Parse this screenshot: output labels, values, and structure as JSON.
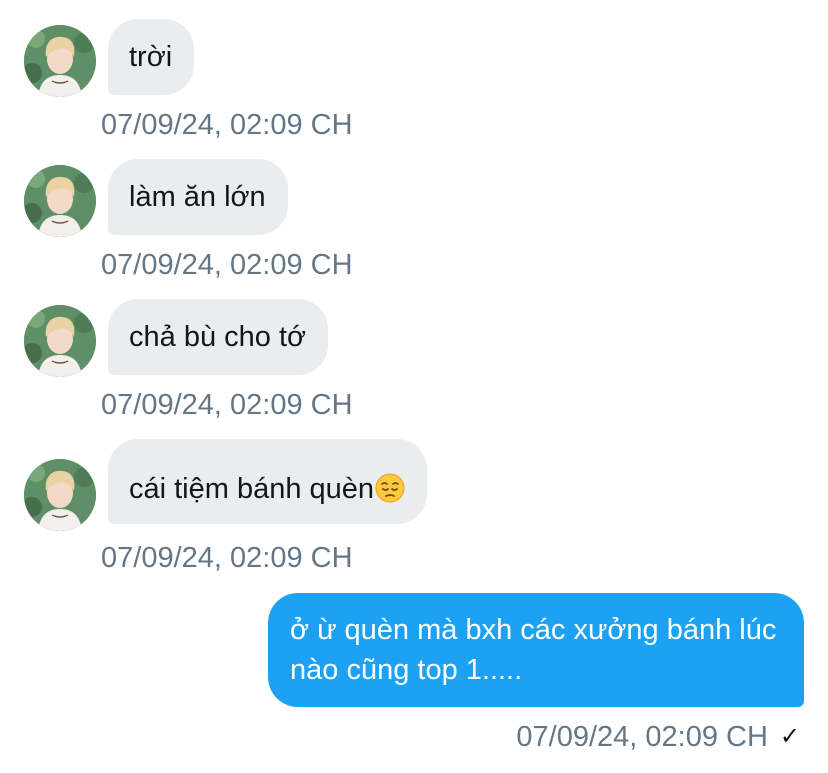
{
  "colors": {
    "incoming_bubble": "#eaedf0",
    "outgoing_bubble": "#1da1f2",
    "timestamp": "#657786",
    "text": "#14171a"
  },
  "messages": [
    {
      "direction": "incoming",
      "text": "trời",
      "time": "07/09/24, 02:09 CH"
    },
    {
      "direction": "incoming",
      "text": "làm ăn lớn",
      "time": "07/09/24, 02:09 CH"
    },
    {
      "direction": "incoming",
      "text": "chả bù cho tớ",
      "time": "07/09/24, 02:09 CH"
    },
    {
      "direction": "incoming",
      "text": "cái tiệm bánh quèn",
      "emoji": "pensive-face",
      "time": "07/09/24, 02:09 CH"
    },
    {
      "direction": "outgoing",
      "text": "ở ừ quèn mà bxh các xưởng bánh lúc nào cũng top 1.....",
      "time": "07/09/24, 02:09 CH",
      "status_icon": "checkmark-icon",
      "status_glyph": "✓"
    }
  ]
}
